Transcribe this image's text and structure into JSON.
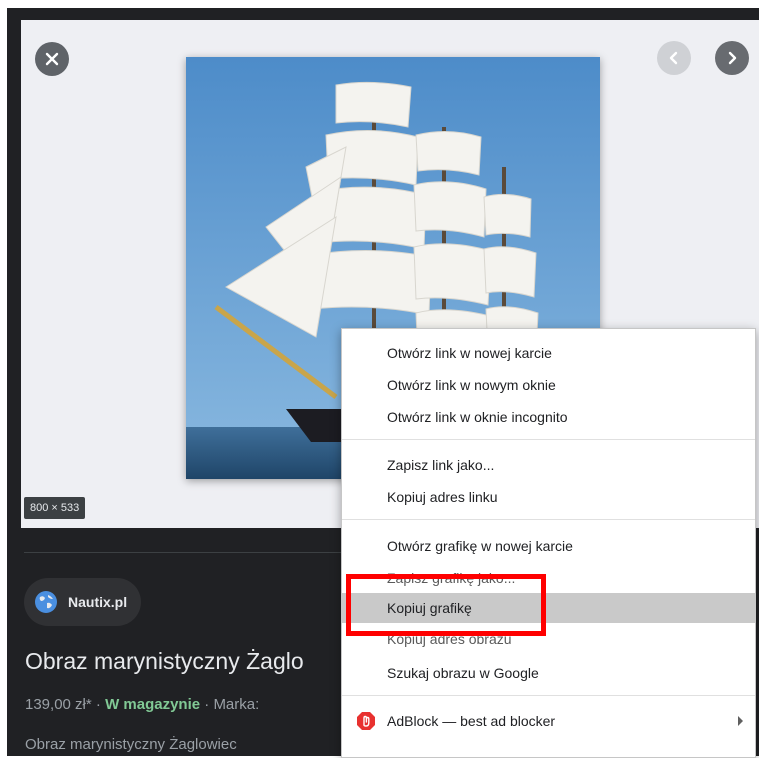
{
  "viewer": {
    "image_dims": "800 × 533",
    "source": {
      "name": "Nautix.pl"
    },
    "title": "Obraz marynistyczny Żaglo",
    "meta": {
      "price": "139,00 zł*",
      "sep1": " · ",
      "stock": "W magazynie",
      "sep2": " · ",
      "brand_label": "Marka:"
    },
    "subtitle": "Obraz marynistyczny Żaglowiec"
  },
  "context_menu": {
    "items": [
      {
        "label": "Otwórz link w nowej karcie"
      },
      {
        "label": "Otwórz link w nowym oknie"
      },
      {
        "label": "Otwórz link w oknie incognito"
      },
      {
        "label": "Zapisz link jako..."
      },
      {
        "label": "Kopiuj adres linku"
      },
      {
        "label": "Otwórz grafikę w nowej karcie"
      },
      {
        "label": "Zapisz grafikę jako..."
      },
      {
        "label": "Kopiuj grafikę"
      },
      {
        "label": "Kopiuj adres obrazu"
      },
      {
        "label": "Szukaj obrazu w Google"
      },
      {
        "label": "AdBlock — best ad blocker"
      }
    ],
    "hovered_item": "Kopiuj grafikę"
  },
  "colors": {
    "panel_bg": "#202124",
    "viewer_bg": "#eeeff3",
    "stock_green": "#81c995",
    "highlight_red": "#ff0000",
    "adblock_red": "#e8312f"
  },
  "icons": [
    "close-icon",
    "chevron-left-icon",
    "chevron-right-icon",
    "globe-icon",
    "adblock-icon",
    "chevron-right-submenu-icon"
  ]
}
